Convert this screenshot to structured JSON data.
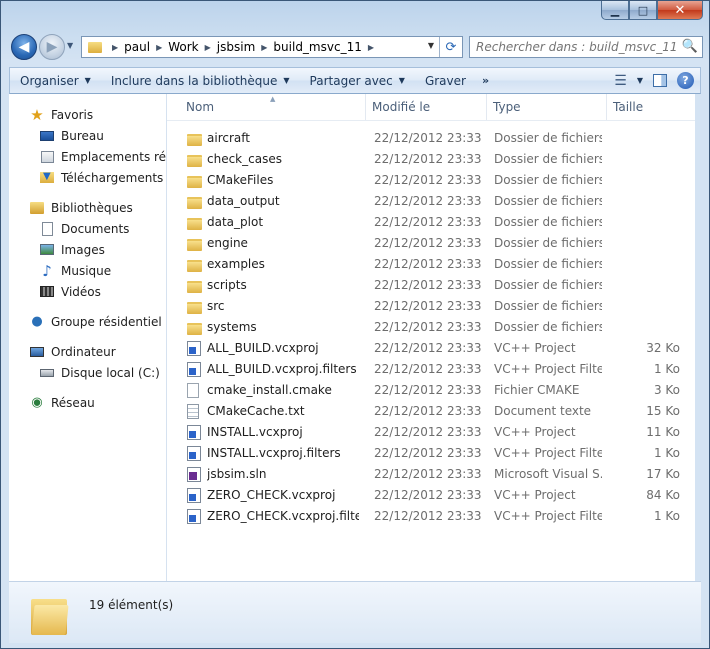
{
  "window": {
    "caption_buttons": {
      "minimize": "▁",
      "maximize": "□",
      "close": "✕"
    }
  },
  "address_bar": {
    "breadcrumbs": [
      "paul",
      "Work",
      "jsbsim",
      "build_msvc_11"
    ],
    "icons": {
      "back": "arrow-left-icon",
      "forward": "arrow-right-icon",
      "refresh": "refresh-icon"
    }
  },
  "search": {
    "placeholder": "Rechercher dans : build_msvc_11",
    "icon": "🔍"
  },
  "toolbar": {
    "organize": "Organiser",
    "include_library": "Inclure dans la bibliothèque",
    "share": "Partager avec",
    "burn": "Graver",
    "more": "»",
    "views_icon": "☰",
    "help": "?"
  },
  "nav_pane": {
    "favorites": {
      "label": "Favoris",
      "items": [
        {
          "label": "Bureau"
        },
        {
          "label": "Emplacements récents"
        },
        {
          "label": "Téléchargements"
        }
      ]
    },
    "libraries": {
      "label": "Bibliothèques",
      "items": [
        {
          "label": "Documents"
        },
        {
          "label": "Images"
        },
        {
          "label": "Musique"
        },
        {
          "label": "Vidéos"
        }
      ]
    },
    "homegroup": {
      "label": "Groupe résidentiel"
    },
    "computer": {
      "label": "Ordinateur",
      "items": [
        {
          "label": "Disque local (C:)"
        }
      ]
    },
    "network": {
      "label": "Réseau"
    }
  },
  "columns": {
    "name": "Nom",
    "modified": "Modifié le",
    "type": "Type",
    "size": "Taille"
  },
  "files": [
    {
      "name": "aircraft",
      "date": "22/12/2012 23:33",
      "type": "Dossier de fichiers",
      "size": "",
      "icon": "folder"
    },
    {
      "name": "check_cases",
      "date": "22/12/2012 23:33",
      "type": "Dossier de fichiers",
      "size": "",
      "icon": "folder"
    },
    {
      "name": "CMakeFiles",
      "date": "22/12/2012 23:33",
      "type": "Dossier de fichiers",
      "size": "",
      "icon": "folder"
    },
    {
      "name": "data_output",
      "date": "22/12/2012 23:33",
      "type": "Dossier de fichiers",
      "size": "",
      "icon": "folder"
    },
    {
      "name": "data_plot",
      "date": "22/12/2012 23:33",
      "type": "Dossier de fichiers",
      "size": "",
      "icon": "folder"
    },
    {
      "name": "engine",
      "date": "22/12/2012 23:33",
      "type": "Dossier de fichiers",
      "size": "",
      "icon": "folder"
    },
    {
      "name": "examples",
      "date": "22/12/2012 23:33",
      "type": "Dossier de fichiers",
      "size": "",
      "icon": "folder"
    },
    {
      "name": "scripts",
      "date": "22/12/2012 23:33",
      "type": "Dossier de fichiers",
      "size": "",
      "icon": "folder"
    },
    {
      "name": "src",
      "date": "22/12/2012 23:33",
      "type": "Dossier de fichiers",
      "size": "",
      "icon": "folder"
    },
    {
      "name": "systems",
      "date": "22/12/2012 23:33",
      "type": "Dossier de fichiers",
      "size": "",
      "icon": "folder"
    },
    {
      "name": "ALL_BUILD.vcxproj",
      "date": "22/12/2012 23:33",
      "type": "VC++ Project",
      "size": "32 Ko",
      "icon": "vcxproj"
    },
    {
      "name": "ALL_BUILD.vcxproj.filters",
      "date": "22/12/2012 23:33",
      "type": "VC++ Project Filte...",
      "size": "1 Ko",
      "icon": "vcxproj"
    },
    {
      "name": "cmake_install.cmake",
      "date": "22/12/2012 23:33",
      "type": "Fichier CMAKE",
      "size": "3 Ko",
      "icon": "cmake"
    },
    {
      "name": "CMakeCache.txt",
      "date": "22/12/2012 23:33",
      "type": "Document texte",
      "size": "15 Ko",
      "icon": "txt"
    },
    {
      "name": "INSTALL.vcxproj",
      "date": "22/12/2012 23:33",
      "type": "VC++ Project",
      "size": "11 Ko",
      "icon": "vcxproj"
    },
    {
      "name": "INSTALL.vcxproj.filters",
      "date": "22/12/2012 23:33",
      "type": "VC++ Project Filte...",
      "size": "1 Ko",
      "icon": "vcxproj"
    },
    {
      "name": "jsbsim.sln",
      "date": "22/12/2012 23:33",
      "type": "Microsoft Visual S...",
      "size": "17 Ko",
      "icon": "sln"
    },
    {
      "name": "ZERO_CHECK.vcxproj",
      "date": "22/12/2012 23:33",
      "type": "VC++ Project",
      "size": "84 Ko",
      "icon": "vcxproj"
    },
    {
      "name": "ZERO_CHECK.vcxproj.filters",
      "date": "22/12/2012 23:33",
      "type": "VC++ Project Filte...",
      "size": "1 Ko",
      "icon": "vcxproj"
    }
  ],
  "status": {
    "count": "19 élément(s)"
  }
}
